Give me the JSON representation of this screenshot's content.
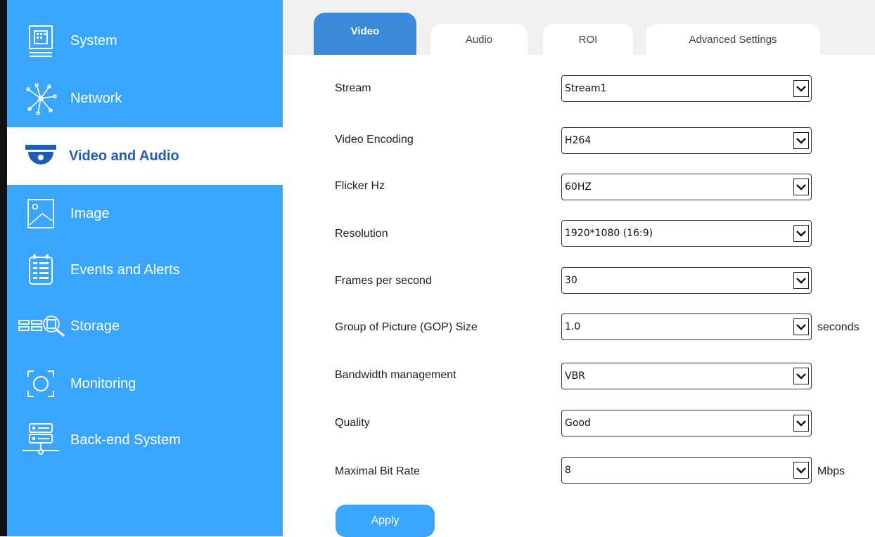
{
  "sidebar": {
    "items": [
      {
        "label": "System",
        "icon": "computer-icon"
      },
      {
        "label": "Network",
        "icon": "network-icon"
      },
      {
        "label": "Video and Audio",
        "icon": "camera-icon"
      },
      {
        "label": "Image",
        "icon": "image-icon"
      },
      {
        "label": "Events and Alerts",
        "icon": "events-icon"
      },
      {
        "label": "Storage",
        "icon": "storage-icon"
      },
      {
        "label": "Monitoring",
        "icon": "monitoring-icon"
      },
      {
        "label": "Back-end System",
        "icon": "server-icon"
      }
    ],
    "active_index": 2
  },
  "tabs": [
    {
      "label": "Video"
    },
    {
      "label": "Audio"
    },
    {
      "label": "ROI"
    },
    {
      "label": "Advanced Settings"
    }
  ],
  "form": {
    "stream": {
      "label": "Stream",
      "value": "Stream1"
    },
    "video_encoding": {
      "label": "Video Encoding",
      "value": "H264"
    },
    "flicker": {
      "label": "Flicker Hz",
      "value": "60HZ"
    },
    "resolution": {
      "label": "Resolution",
      "value": "1920*1080 (16:9)"
    },
    "fps": {
      "label": "Frames per second",
      "value": "30"
    },
    "gop": {
      "label": "Group of Picture (GOP) Size",
      "value": "1.0",
      "unit": "seconds"
    },
    "bandwidth": {
      "label": "Bandwidth management",
      "value": "VBR"
    },
    "quality": {
      "label": "Quality",
      "value": "Good"
    },
    "bitrate": {
      "label": "Maximal Bit Rate",
      "value": "8",
      "unit": "Mbps"
    }
  },
  "apply_label": "Apply",
  "colors": {
    "sidebar_bg": "#3aa5fc",
    "active_tab": "#3b8ad9",
    "active_text": "#1e5db4"
  }
}
